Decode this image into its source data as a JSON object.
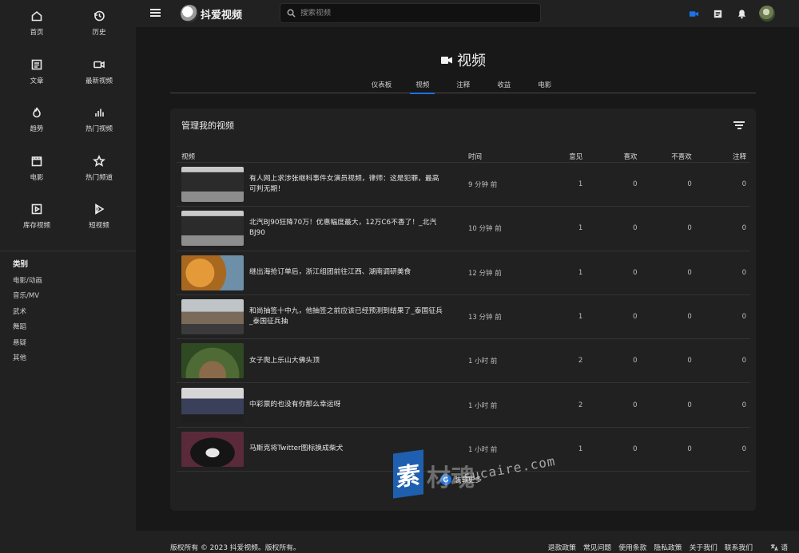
{
  "app": {
    "name": "抖爱视频"
  },
  "search": {
    "placeholder": "搜索视频"
  },
  "sidebar": {
    "nav": [
      {
        "label": "首页",
        "icon": "home-icon"
      },
      {
        "label": "历史",
        "icon": "history-icon"
      },
      {
        "label": "文章",
        "icon": "article-icon"
      },
      {
        "label": "最新视频",
        "icon": "video-camera-icon"
      },
      {
        "label": "趋势",
        "icon": "flame-icon"
      },
      {
        "label": "热门视频",
        "icon": "bar-chart-icon"
      },
      {
        "label": "电影",
        "icon": "clapperboard-icon"
      },
      {
        "label": "热门频道",
        "icon": "star-icon"
      },
      {
        "label": "库存视频",
        "icon": "play-box-icon"
      },
      {
        "label": "短视频",
        "icon": "shorts-icon"
      }
    ],
    "categories_title": "类别",
    "categories": [
      "电影/动画",
      "音乐/MV",
      "武术",
      "舞蹈",
      "悬疑",
      "其他"
    ]
  },
  "page": {
    "title": "视频",
    "tabs": [
      "仪表板",
      "视频",
      "注释",
      "收益",
      "电影"
    ],
    "active_tab": "视频"
  },
  "card": {
    "title": "管理我的视频"
  },
  "table": {
    "headers": [
      "视频",
      "时间",
      "意见",
      "喜欢",
      "不喜欢",
      "注释"
    ],
    "rows": [
      {
        "title": "有人网上求涉张继科事件女演员视频，律师：这是犯罪，最高可判无期！",
        "time": "9 分钟 前",
        "views": "1",
        "likes": "0",
        "dislikes": "0",
        "comments": "0"
      },
      {
        "title": "北汽BJ90狂降70万！优惠幅度最大，12万C6不香了！_北汽BJ90",
        "time": "10 分钟 前",
        "views": "1",
        "likes": "0",
        "dislikes": "0",
        "comments": "0"
      },
      {
        "title": "继出海抢订单后，浙江组团前往江西、湖南调研美食",
        "time": "12 分钟 前",
        "views": "1",
        "likes": "0",
        "dislikes": "0",
        "comments": "0"
      },
      {
        "title": "和尚抽签十中九，他抽签之前应该已经预测到结果了_泰国征兵 _泰国征兵抽",
        "time": "13 分钟 前",
        "views": "1",
        "likes": "0",
        "dislikes": "0",
        "comments": "0"
      },
      {
        "title": "女子爬上乐山大佛头顶",
        "time": "1 小时 前",
        "views": "2",
        "likes": "0",
        "dislikes": "0",
        "comments": "0"
      },
      {
        "title": "中彩票的也没有你那么幸运呀",
        "time": "1 小时 前",
        "views": "2",
        "likes": "0",
        "dislikes": "0",
        "comments": "0"
      },
      {
        "title": "马斯克将Twitter图标换成柴犬",
        "time": "1 小时 前",
        "views": "1",
        "likes": "0",
        "dislikes": "0",
        "comments": "0"
      }
    ]
  },
  "load_more": "装载更多",
  "footer": {
    "copyright": "版权所有 © 2023 抖爱视频。版权所有。",
    "links": [
      "退款政策",
      "常见问题",
      "使用条款",
      "隐私政策",
      "关于我们",
      "联系我们"
    ],
    "language": "语"
  },
  "watermark": {
    "char": "素",
    "ghost": "材魂",
    "url": "sucaire.com"
  },
  "colors": {
    "accent": "#1a73e8",
    "background": "#181818",
    "panel": "#212121"
  }
}
